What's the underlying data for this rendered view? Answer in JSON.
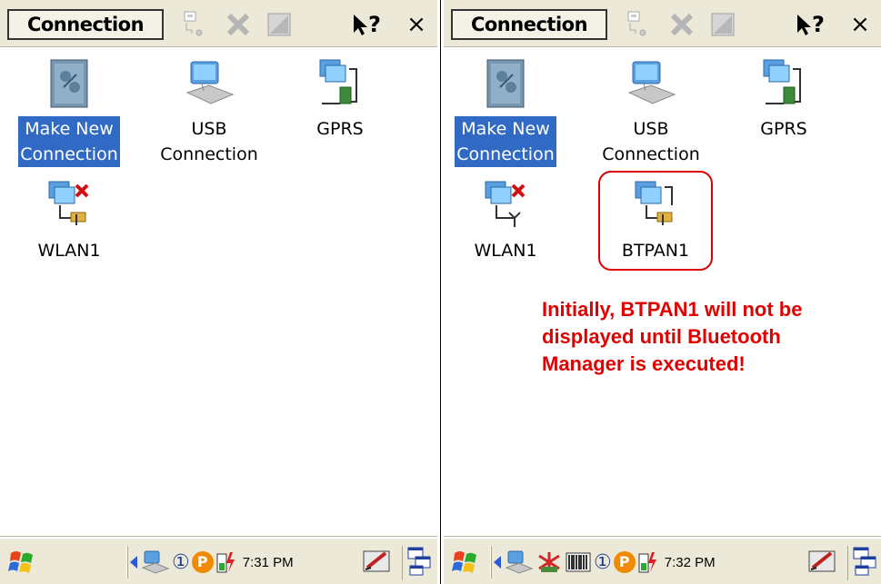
{
  "left": {
    "title": "Connection",
    "items": [
      {
        "label": "Make New\nConnection",
        "selected": true
      },
      {
        "label": "USB\nConnection",
        "selected": false
      },
      {
        "label": "GPRS",
        "selected": false
      },
      {
        "label": "WLAN1",
        "selected": false
      }
    ],
    "time": "7:31 PM"
  },
  "right": {
    "title": "Connection",
    "items": [
      {
        "label": "Make New\nConnection",
        "selected": true
      },
      {
        "label": "USB\nConnection",
        "selected": false
      },
      {
        "label": "GPRS",
        "selected": false
      },
      {
        "label": "WLAN1",
        "selected": false
      },
      {
        "label": "BTPAN1",
        "selected": false
      }
    ],
    "annotation": "Initially, BTPAN1 will not be\ndisplayed until Bluetooth\nManager is executed!",
    "time": "7:32 PM"
  },
  "icons": {
    "help": "?",
    "close": "×",
    "tray_numbers": "①",
    "tray_p": "P"
  },
  "colors": {
    "selection": "#316ac5",
    "annotation": "#e00000",
    "chrome": "#ece9d8"
  }
}
